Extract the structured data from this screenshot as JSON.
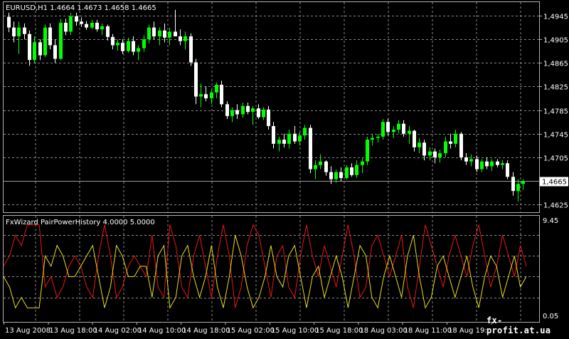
{
  "main_chart": {
    "symbol_header": "EURUSD,H1  1.4664 1.4673 1.4658 1.4665",
    "current_price_label": "1,4665",
    "y_ticks": [
      "1,4945",
      "1,4905",
      "1,4865",
      "1,4825",
      "1,4785",
      "1,4745",
      "1,4705",
      "1,4625"
    ],
    "bull_color": "#00ff00",
    "bear_color": "#ffffff"
  },
  "indicator": {
    "name": "FxWizard PairPowerHistory 4.0000 5.0000",
    "scale_top": "9.45",
    "scale_bottom": "0.05",
    "series_colors": [
      "#e81818",
      "#e8e020"
    ]
  },
  "x_axis": {
    "labels": [
      "13 Aug 2008",
      "13 Aug 18:00",
      "14 Aug 02:00",
      "14 Aug 10:00",
      "14 Aug 18:00",
      "15 Aug 02:00",
      "15 Aug 10:00",
      "15 Aug 18:00",
      "18 Aug 03:00",
      "18 Aug 11:00",
      "18 Aug 19:00",
      "19"
    ]
  },
  "watermark": "fx-profit.at.ua",
  "chart_data": [
    {
      "type": "candlestick",
      "title": "EURUSD,H1",
      "ylim": [
        1.4612,
        1.4968
      ],
      "grid": true,
      "candles": [
        [
          1.4943,
          1.495,
          1.4917,
          1.4925
        ],
        [
          1.4925,
          1.4935,
          1.49,
          1.491
        ],
        [
          1.491,
          1.4935,
          1.488,
          1.4925
        ],
        [
          1.4925,
          1.4932,
          1.4905,
          1.4914
        ],
        [
          1.4914,
          1.492,
          1.486,
          1.487
        ],
        [
          1.487,
          1.491,
          1.4865,
          1.49
        ],
        [
          1.49,
          1.4905,
          1.487,
          1.4878
        ],
        [
          1.4878,
          1.493,
          1.4875,
          1.4925
        ],
        [
          1.4925,
          1.4932,
          1.4888,
          1.4895
        ],
        [
          1.4895,
          1.4905,
          1.4865,
          1.4872
        ],
        [
          1.4872,
          1.494,
          1.487,
          1.4933
        ],
        [
          1.4933,
          1.494,
          1.4912,
          1.4918
        ],
        [
          1.4918,
          1.495,
          1.4912,
          1.4944
        ],
        [
          1.4944,
          1.495,
          1.4928,
          1.4935
        ],
        [
          1.4935,
          1.4942,
          1.4926,
          1.4931
        ],
        [
          1.4931,
          1.4936,
          1.4921,
          1.4925
        ],
        [
          1.4925,
          1.4938,
          1.4922,
          1.4933
        ],
        [
          1.4933,
          1.4938,
          1.4918,
          1.4922
        ],
        [
          1.4922,
          1.4932,
          1.4912,
          1.4927
        ],
        [
          1.4927,
          1.493,
          1.4903,
          1.4909
        ],
        [
          1.4909,
          1.4914,
          1.4888,
          1.4895
        ],
        [
          1.4895,
          1.4905,
          1.4886,
          1.4899
        ],
        [
          1.4899,
          1.4905,
          1.488,
          1.4885
        ],
        [
          1.4885,
          1.4908,
          1.4882,
          1.4902
        ],
        [
          1.4902,
          1.491,
          1.4878,
          1.4884
        ],
        [
          1.4884,
          1.4895,
          1.487,
          1.489
        ],
        [
          1.489,
          1.4912,
          1.4884,
          1.4905
        ],
        [
          1.4905,
          1.493,
          1.4898,
          1.4925
        ],
        [
          1.4925,
          1.4935,
          1.4905,
          1.491
        ],
        [
          1.491,
          1.4925,
          1.4895,
          1.492
        ],
        [
          1.492,
          1.4932,
          1.49,
          1.4908
        ],
        [
          1.4908,
          1.4925,
          1.4895,
          1.4918
        ],
        [
          1.4918,
          1.4955,
          1.4912,
          1.491
        ],
        [
          1.491,
          1.4922,
          1.4895,
          1.4902
        ],
        [
          1.4902,
          1.4918,
          1.4888,
          1.491
        ],
        [
          1.491,
          1.4915,
          1.486,
          1.4866
        ],
        [
          1.4866,
          1.4872,
          1.4795,
          1.4808
        ],
        [
          1.4808,
          1.483,
          1.479,
          1.4812
        ],
        [
          1.4812,
          1.4825,
          1.48,
          1.4805
        ],
        [
          1.4805,
          1.482,
          1.4795,
          1.4815
        ],
        [
          1.4815,
          1.4832,
          1.4805,
          1.4828
        ],
        [
          1.4828,
          1.4835,
          1.479,
          1.4795
        ],
        [
          1.4795,
          1.48,
          1.477,
          1.4775
        ],
        [
          1.4775,
          1.479,
          1.4765,
          1.4785
        ],
        [
          1.4785,
          1.4795,
          1.477,
          1.4778
        ],
        [
          1.4778,
          1.4798,
          1.4772,
          1.4792
        ],
        [
          1.4792,
          1.4798,
          1.4778,
          1.4782
        ],
        [
          1.4782,
          1.4792,
          1.476,
          1.4788
        ],
        [
          1.4788,
          1.4795,
          1.477,
          1.4773
        ],
        [
          1.4773,
          1.479,
          1.4768,
          1.4786
        ],
        [
          1.4786,
          1.4792,
          1.4752,
          1.4758
        ],
        [
          1.4758,
          1.4765,
          1.472,
          1.4728
        ],
        [
          1.4728,
          1.474,
          1.4715,
          1.4735
        ],
        [
          1.4735,
          1.4745,
          1.4722,
          1.4728
        ],
        [
          1.4728,
          1.4752,
          1.472,
          1.4745
        ],
        [
          1.4745,
          1.4758,
          1.4728,
          1.4732
        ],
        [
          1.4732,
          1.4748,
          1.4725,
          1.4742
        ],
        [
          1.4742,
          1.476,
          1.4735,
          1.4755
        ],
        [
          1.4755,
          1.476,
          1.4678,
          1.4685
        ],
        [
          1.4685,
          1.47,
          1.4668,
          1.4692
        ],
        [
          1.4692,
          1.471,
          1.4685,
          1.4698
        ],
        [
          1.4698,
          1.47,
          1.4674,
          1.468
        ],
        [
          1.468,
          1.469,
          1.466,
          1.4668
        ],
        [
          1.4668,
          1.4684,
          1.4662,
          1.468
        ],
        [
          1.468,
          1.4688,
          1.4665,
          1.467
        ],
        [
          1.467,
          1.4692,
          1.4668,
          1.4688
        ],
        [
          1.4688,
          1.4695,
          1.4672,
          1.4675
        ],
        [
          1.4675,
          1.47,
          1.467,
          1.4692
        ],
        [
          1.4692,
          1.4705,
          1.4678,
          1.4698
        ],
        [
          1.4698,
          1.474,
          1.4692,
          1.4735
        ],
        [
          1.4735,
          1.4745,
          1.4725,
          1.4738
        ],
        [
          1.4738,
          1.4745,
          1.473,
          1.474
        ],
        [
          1.474,
          1.477,
          1.4735,
          1.4765
        ],
        [
          1.4765,
          1.477,
          1.4742,
          1.4748
        ],
        [
          1.4748,
          1.4758,
          1.4738,
          1.4752
        ],
        [
          1.4752,
          1.4768,
          1.4746,
          1.4762
        ],
        [
          1.4762,
          1.4768,
          1.474,
          1.4745
        ],
        [
          1.4745,
          1.4758,
          1.4728,
          1.475
        ],
        [
          1.475,
          1.4752,
          1.4715,
          1.4722
        ],
        [
          1.4722,
          1.4738,
          1.4712,
          1.473
        ],
        [
          1.473,
          1.4735,
          1.47,
          1.4708
        ],
        [
          1.4708,
          1.4722,
          1.47,
          1.4715
        ],
        [
          1.4715,
          1.472,
          1.4695,
          1.4705
        ],
        [
          1.4705,
          1.4718,
          1.4696,
          1.4712
        ],
        [
          1.4712,
          1.474,
          1.4705,
          1.4732
        ],
        [
          1.4732,
          1.4745,
          1.472,
          1.4728
        ],
        [
          1.4728,
          1.4752,
          1.4722,
          1.4745
        ],
        [
          1.4745,
          1.4748,
          1.47,
          1.4705
        ],
        [
          1.4705,
          1.4712,
          1.4692,
          1.4698
        ],
        [
          1.4698,
          1.471,
          1.469,
          1.4702
        ],
        [
          1.4702,
          1.4708,
          1.468,
          1.4685
        ],
        [
          1.4685,
          1.4702,
          1.468,
          1.4698
        ],
        [
          1.4698,
          1.4705,
          1.4685,
          1.469
        ],
        [
          1.469,
          1.4702,
          1.4682,
          1.4698
        ],
        [
          1.4698,
          1.4702,
          1.4688,
          1.4692
        ],
        [
          1.4692,
          1.47,
          1.4685,
          1.4695
        ],
        [
          1.4695,
          1.47,
          1.4668,
          1.4672
        ],
        [
          1.4672,
          1.468,
          1.464,
          1.4648
        ],
        [
          1.4648,
          1.4668,
          1.463,
          1.466
        ],
        [
          1.466,
          1.4668,
          1.465,
          1.4665
        ]
      ]
    },
    {
      "type": "line",
      "title": "FxWizard PairPowerHistory 4.0000 5.0000",
      "ylim": [
        0.05,
        9.45
      ],
      "series": [
        {
          "values": [
            5,
            6,
            8,
            7,
            9,
            9,
            9,
            3,
            4,
            2,
            3,
            5,
            6,
            5,
            3,
            2,
            6,
            9,
            6,
            2,
            3,
            5,
            6,
            5,
            4,
            8,
            3,
            2,
            9,
            7,
            3,
            2,
            6,
            8,
            5,
            2,
            6,
            9,
            6,
            1,
            3,
            7,
            9,
            8,
            5,
            2,
            6,
            7,
            3,
            2,
            6,
            9,
            6,
            4,
            7,
            5,
            3,
            6,
            9,
            6,
            2,
            3,
            7,
            8,
            6,
            4,
            6,
            8,
            3,
            1,
            5,
            9,
            7,
            5,
            3,
            6,
            8,
            6,
            4,
            7,
            9,
            6,
            3,
            5,
            8,
            6,
            4,
            7,
            5
          ]
        },
        {
          "values": [
            4,
            3,
            1,
            2,
            1,
            1,
            1,
            6,
            5,
            7,
            6,
            4,
            4,
            5,
            6,
            7,
            4,
            1,
            3,
            7,
            6,
            4,
            4,
            5,
            5,
            2,
            6,
            7,
            1,
            2,
            6,
            7,
            4,
            2,
            4,
            7,
            3,
            1,
            4,
            8,
            6,
            3,
            1,
            2,
            4,
            7,
            4,
            3,
            6,
            7,
            4,
            1,
            4,
            5,
            2,
            4,
            6,
            4,
            1,
            4,
            7,
            6,
            2,
            1,
            4,
            6,
            4,
            2,
            6,
            8,
            4,
            1,
            2,
            5,
            6,
            4,
            2,
            4,
            6,
            3,
            1,
            4,
            6,
            5,
            2,
            4,
            6,
            3,
            4
          ]
        }
      ]
    }
  ]
}
